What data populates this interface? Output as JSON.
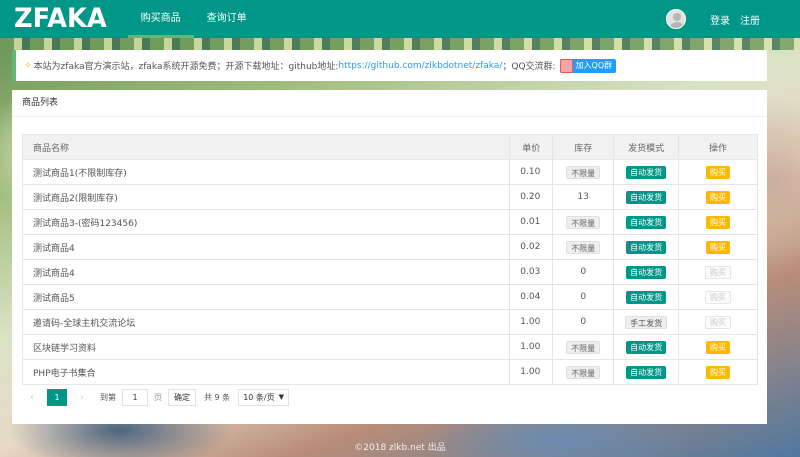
{
  "header": {
    "logo": "ZFAKA",
    "nav": [
      "购买商品",
      "查询订单"
    ],
    "login": "登录",
    "register": "注册"
  },
  "notice": {
    "text_before": "本站为zfaka官方演示站，zfaka系统开源免费；开源下载地址：github地址:",
    "link": "https://github.com/zlkbdotnet/zfaka/",
    "text_after": "；QQ交流群:",
    "qq_button": "加入QQ群"
  },
  "card": {
    "title": "商品列表",
    "columns": [
      "商品名称",
      "单价",
      "库存",
      "发货模式",
      "操作"
    ],
    "rows": [
      {
        "name": "测试商品1(不限制库存)",
        "price": "0.10",
        "stock": "不限量",
        "mode": "自动发货",
        "op": "购买",
        "enabled": true
      },
      {
        "name": "测试商品2(限制库存)",
        "price": "0.20",
        "stock": "13",
        "mode": "自动发货",
        "op": "购买",
        "enabled": true
      },
      {
        "name": "测试商品3-(密码123456)",
        "price": "0.01",
        "stock": "不限量",
        "mode": "自动发货",
        "op": "购买",
        "enabled": true
      },
      {
        "name": "测试商品4",
        "price": "0.02",
        "stock": "不限量",
        "mode": "自动发货",
        "op": "购买",
        "enabled": true
      },
      {
        "name": "测试商品4",
        "price": "0.03",
        "stock": "0",
        "mode": "自动发货",
        "op": "购买",
        "enabled": false
      },
      {
        "name": "测试商品5",
        "price": "0.04",
        "stock": "0",
        "mode": "自动发货",
        "op": "购买",
        "enabled": false
      },
      {
        "name": "邀请码-全球主机交流论坛",
        "price": "1.00",
        "stock": "0",
        "mode": "手工发货",
        "op": "购买",
        "enabled": false
      },
      {
        "name": "区块链学习资料",
        "price": "1.00",
        "stock": "不限量",
        "mode": "自动发货",
        "op": "购买",
        "enabled": true
      },
      {
        "name": "PHP电子书集合",
        "price": "1.00",
        "stock": "不限量",
        "mode": "自动发货",
        "op": "购买",
        "enabled": true
      }
    ]
  },
  "pager": {
    "prev": "‹",
    "current": "1",
    "next": "›",
    "goto": "到第",
    "page_input": "1",
    "page_unit": "页",
    "confirm": "确定",
    "total": "共 9 条",
    "per_page": "10 条/页"
  },
  "footer": "©2018 zlkb.net 出品",
  "colors": {
    "primary": "#009688",
    "buy": "#ffb800",
    "link": "#1e9fff"
  }
}
